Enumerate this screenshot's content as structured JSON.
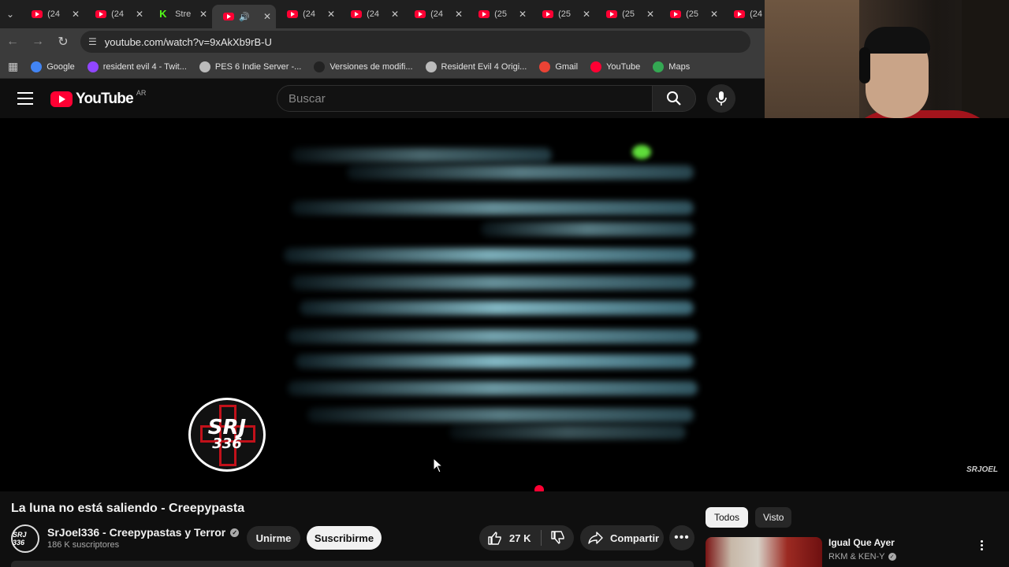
{
  "browser": {
    "tabs": [
      {
        "title": "(24",
        "kind": "youtube"
      },
      {
        "title": "(24",
        "kind": "youtube"
      },
      {
        "title": "Stre",
        "kind": "kick"
      },
      {
        "title": "",
        "kind": "youtube",
        "active": true,
        "audio": true
      },
      {
        "title": "(24",
        "kind": "youtube"
      },
      {
        "title": "(24",
        "kind": "youtube"
      },
      {
        "title": "(24",
        "kind": "youtube"
      },
      {
        "title": "(25",
        "kind": "youtube"
      },
      {
        "title": "(25",
        "kind": "youtube"
      },
      {
        "title": "(25",
        "kind": "youtube"
      },
      {
        "title": "(25",
        "kind": "youtube"
      },
      {
        "title": "(24",
        "kind": "youtube"
      }
    ],
    "url": "youtube.com/watch?v=9xAkXb9rB-U",
    "bookmarks": [
      {
        "label": "Google",
        "color": "#4285f4"
      },
      {
        "label": "resident evil 4 - Twit...",
        "color": "#9146ff"
      },
      {
        "label": "PES 6 Indie Server -...",
        "color": "#bbbbbb"
      },
      {
        "label": "Versiones de modifi...",
        "color": "#222222"
      },
      {
        "label": "Resident Evil 4 Origi...",
        "color": "#bbbbbb"
      },
      {
        "label": "Gmail",
        "color": "#ea4335"
      },
      {
        "label": "YouTube",
        "color": "#ff0033"
      },
      {
        "label": "Maps",
        "color": "#34a853"
      }
    ]
  },
  "masthead": {
    "logo_text": "YouTube",
    "country": "AR",
    "search_placeholder": "Buscar"
  },
  "player": {
    "watermark_text": "SRJ",
    "watermark_number": "336",
    "corner_logo": "SRJOEL"
  },
  "video": {
    "title": "La luna no está saliendo - Creepypasta",
    "channel_name": "SrJoel336 - Creepypastas y Terror",
    "channel_avatar": "SRJ 336",
    "subscribers": "186 K suscriptores",
    "join_label": "Unirme",
    "subscribe_label": "Suscribirme",
    "likes": "27 K",
    "share_label": "Compartir"
  },
  "sidebar": {
    "chips": [
      "Todos",
      "Visto"
    ],
    "recommendation": {
      "title": "Igual Que Ayer",
      "channel": "RKM & KEN-Y"
    }
  },
  "colors": {
    "accent": "#ff0033",
    "background": "#0f0f0f"
  }
}
